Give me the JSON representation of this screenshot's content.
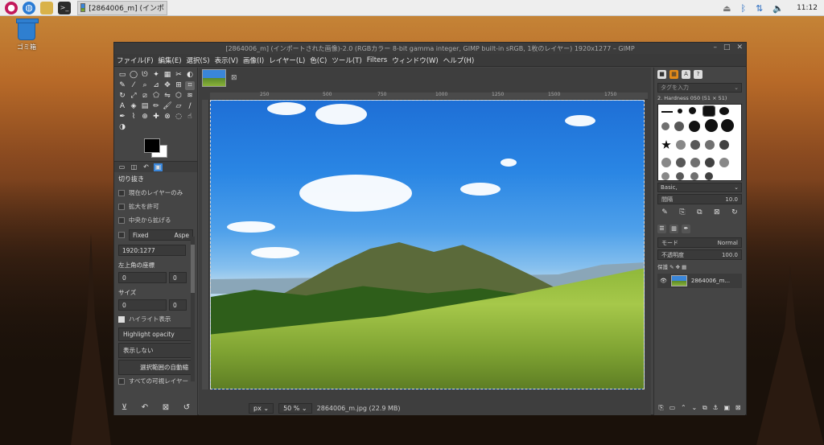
{
  "taskbar": {
    "task_title": "[2864006_m] (インポ",
    "clock": "11:12"
  },
  "desktop": {
    "trash_label": "ゴミ箱"
  },
  "window": {
    "title": "[2864006_m] (インポートされた画像)-2.0 (RGBカラー 8-bit gamma integer, GIMP built-in sRGB, 1枚のレイヤー) 1920x1277 – GIMP",
    "menu": [
      "ファイル(F)",
      "編集(E)",
      "選択(S)",
      "表示(V)",
      "画像(I)",
      "レイヤー(L)",
      "色(C)",
      "ツール(T)",
      "Filters",
      "ウィンドウ(W)",
      "ヘルプ(H)"
    ]
  },
  "toolbox": {
    "tool_options_title": "切り抜き",
    "options": {
      "current_layer_only": "現在のレイヤーのみ",
      "allow_growing": "拡大を許可",
      "expand_from_center": "中央から拡げる",
      "fixed": "Fixed",
      "aspect": "Aspe",
      "ratio_value": "1920:1277",
      "position_label": "左上角の座標",
      "pos_x": "0",
      "pos_y": "0",
      "size_label": "サイズ",
      "size_w": "0",
      "size_h": "0",
      "highlight": "ハイライト表示",
      "highlight_opacity": "Highlight opacity",
      "guides": "表示しない",
      "auto_shrink": "選択範囲の自動縮",
      "shrink_merged": "すべての可視レイヤー"
    }
  },
  "canvas": {
    "ruler_labels": [
      "250",
      "500",
      "750",
      "1000",
      "1250",
      "1500",
      "1750"
    ],
    "unit": "px",
    "zoom": "50 %",
    "file_info": "2864006_m.jpg (22.9 MB)"
  },
  "dock": {
    "tag_placeholder": "タグを入力",
    "brush_name": "2. Hardness 050 (51 × 51)",
    "brush_set": "Basic,",
    "spacing_label": "間隔",
    "spacing_value": "10.0",
    "mode_label": "モード",
    "mode_value": "Normal",
    "opacity_label": "不透明度",
    "opacity_value": "100.0",
    "lock_label": "保護",
    "layer_name": "2864006_m..."
  }
}
